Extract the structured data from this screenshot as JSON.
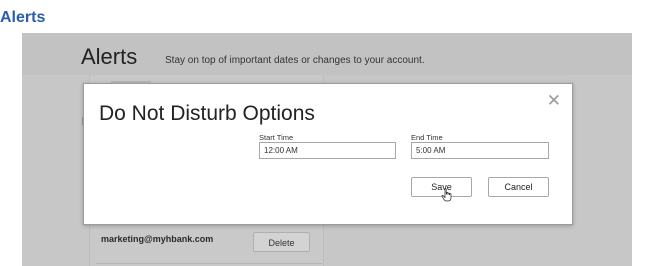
{
  "page": {
    "heading": "Alerts"
  },
  "header": {
    "title": "Alerts",
    "subtitle": "Stay on top of important dates or changes to your account."
  },
  "background_list": {
    "email": "marketing@myhbank.com",
    "delete_label": "Delete"
  },
  "modal": {
    "title": "Do Not Disturb Options",
    "close_symbol": "✕",
    "start_time": {
      "label": "Start Time",
      "value": "12:00 AM"
    },
    "end_time": {
      "label": "End Time",
      "value": "5:00 AM"
    },
    "save_label": "Save",
    "cancel_label": "Cancel"
  },
  "icons": {
    "close": "close-icon",
    "cursor": "hand-pointer-icon"
  },
  "colors": {
    "heading_blue": "#2a5db0",
    "overlay_gray": "#c7c7c7",
    "modal_bg": "#ffffff"
  }
}
